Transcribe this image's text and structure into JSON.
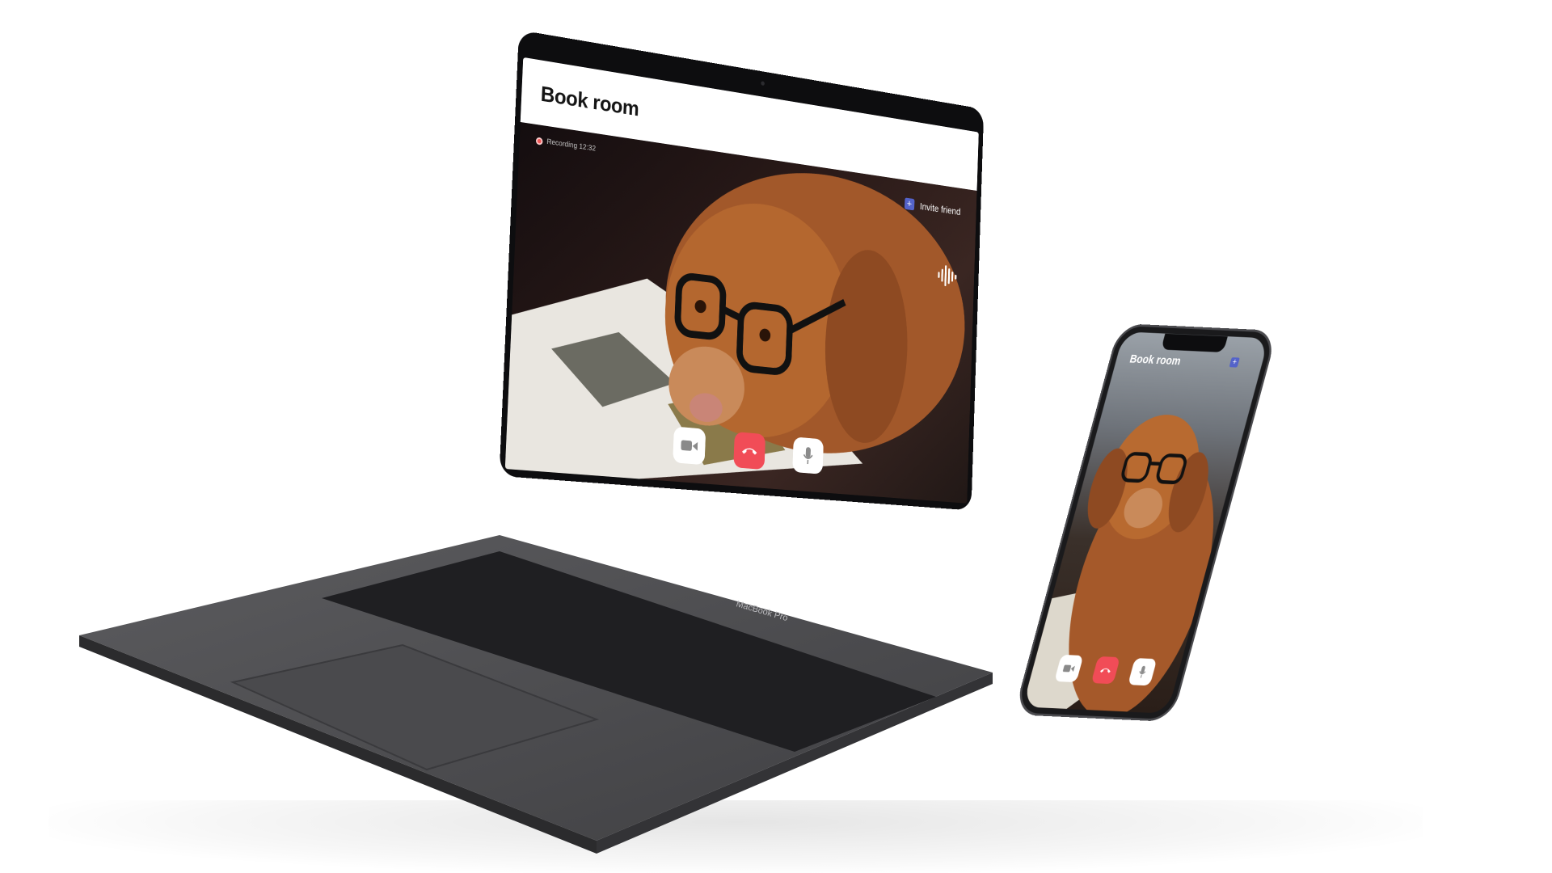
{
  "laptop": {
    "title": "Book room",
    "recording_label": "Recording 12:32",
    "invite_label": "Invite friend",
    "controls": [
      "video-camera",
      "end-call",
      "microphone"
    ],
    "brand_label": "MacBook Pro"
  },
  "phone": {
    "title": "Book room",
    "controls": [
      "video-camera",
      "end-call",
      "microphone"
    ]
  },
  "colors": {
    "accent": "#5463c9",
    "end_call": "#f14c57",
    "recording": "#f05a5a"
  }
}
